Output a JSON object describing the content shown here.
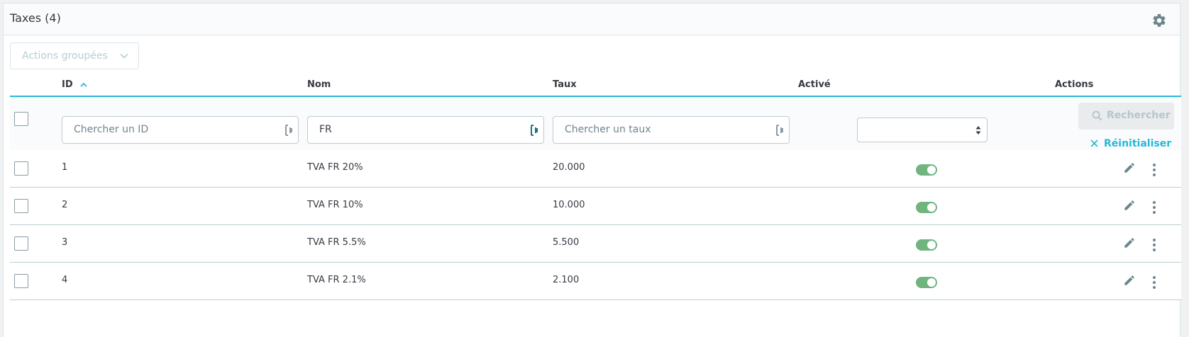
{
  "header": {
    "title": "Taxes (4)",
    "settings_icon": "gear-icon"
  },
  "bulk_actions": {
    "label": "Actions groupées",
    "icon": "chevron-down-icon"
  },
  "columns": {
    "id": "ID",
    "name": "Nom",
    "rate": "Taux",
    "active": "Activé",
    "actions": "Actions",
    "sort_icon": "sort-ascending-icon"
  },
  "filters": {
    "id_placeholder": "Chercher un ID",
    "name_value": "FR",
    "rate_placeholder": "Chercher un taux",
    "active_selected": "",
    "search_label": "Rechercher",
    "reset_label": "Réinitialiser"
  },
  "rows": [
    {
      "id": "1",
      "name": "TVA FR 20%",
      "rate": "20.000",
      "active": true
    },
    {
      "id": "2",
      "name": "TVA FR 10%",
      "rate": "10.000",
      "active": true
    },
    {
      "id": "3",
      "name": "TVA FR 5.5%",
      "rate": "5.500",
      "active": true
    },
    {
      "id": "4",
      "name": "TVA FR 2.1%",
      "rate": "2.100",
      "active": true
    }
  ],
  "colors": {
    "accent": "#25b9d7",
    "toggle_on": "#70b580",
    "icon": "#6c868e"
  }
}
